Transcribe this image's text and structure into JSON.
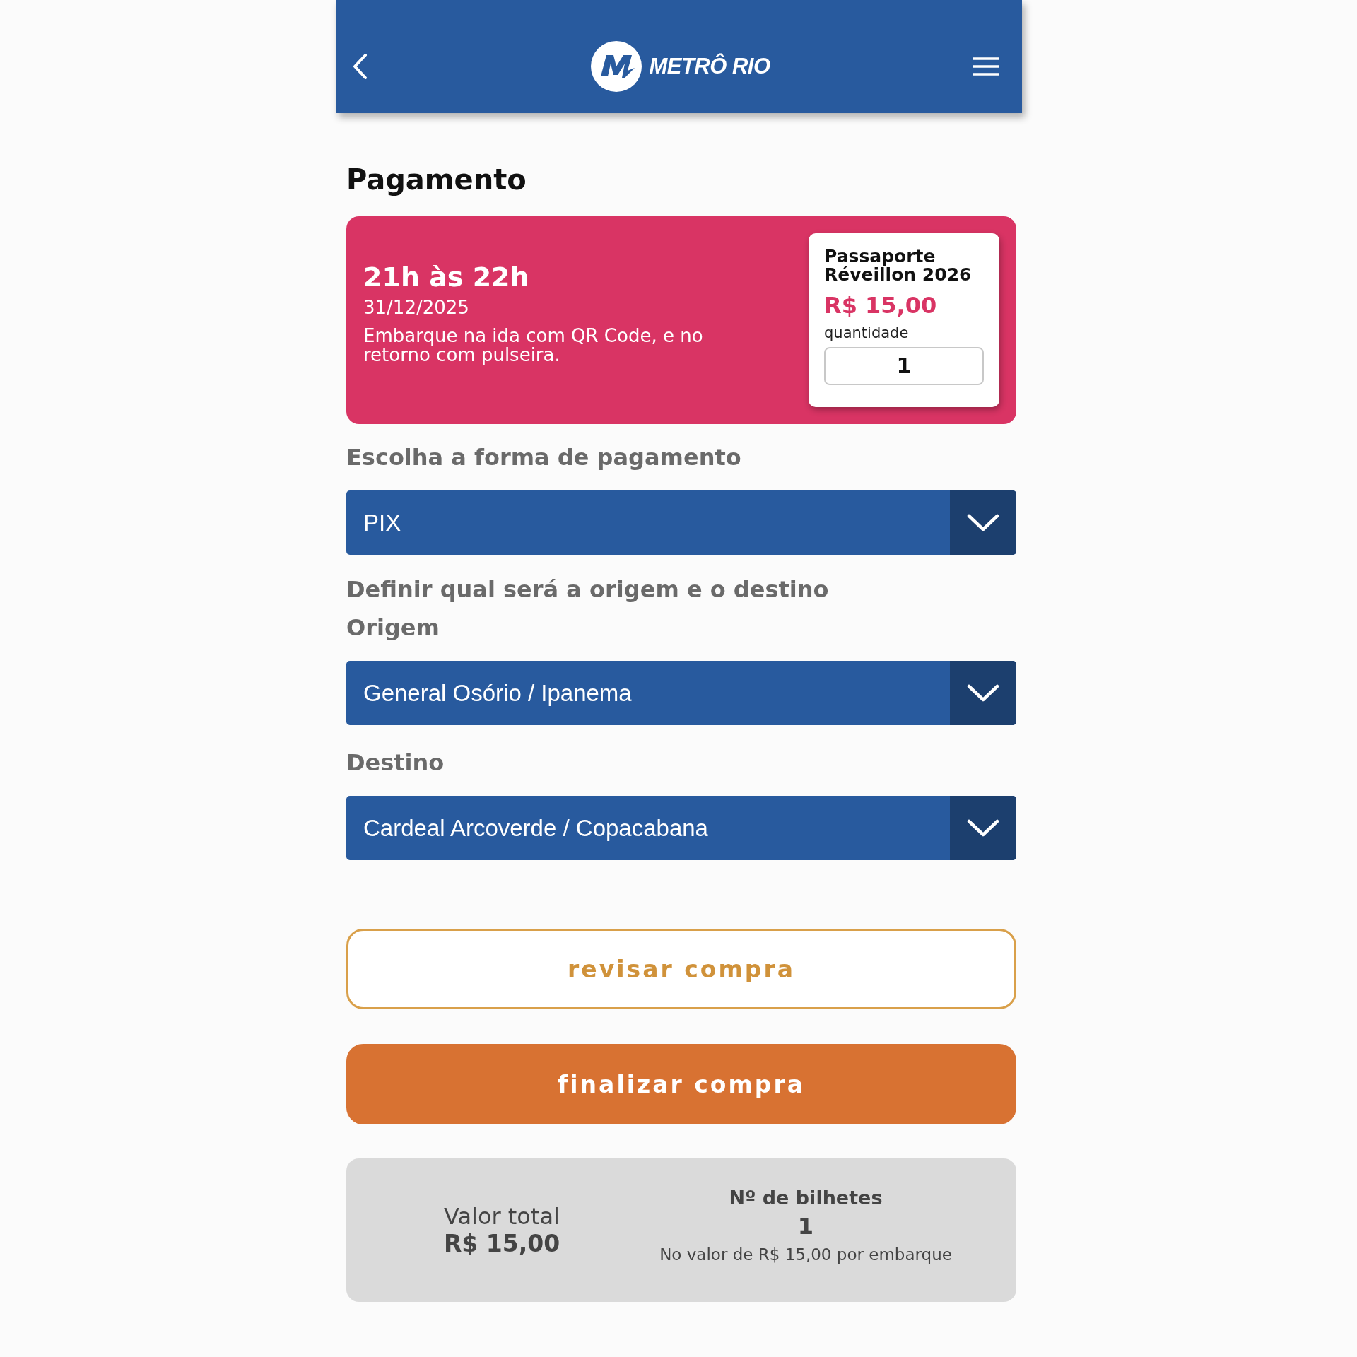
{
  "header": {
    "logo_text": "METRÔ RIO"
  },
  "title": "Pagamento",
  "event_card": {
    "time": "21h às 22h",
    "date": "31/12/2025",
    "note": "Embarque na ida com QR Code, e no retorno com pulseira.",
    "ticket": {
      "name": "Passaporte Réveillon 2026",
      "price": "R$ 15,00",
      "quantity_label": "quantidade",
      "quantity": "1"
    }
  },
  "payment": {
    "label": "Escolha a forma de pagamento",
    "value": "PIX"
  },
  "route": {
    "label": "Definir qual será a origem e o destino",
    "fields": [
      {
        "label": "Origem",
        "value": "General Osório / Ipanema"
      },
      {
        "label": "Destino",
        "value": "Cardeal Arcoverde / Copacabana"
      }
    ]
  },
  "buttons": [
    {
      "label": "revisar compra",
      "kind": "outline"
    },
    {
      "label": "finalizar compra",
      "kind": "filled"
    }
  ],
  "summary": {
    "total_label": "Valor total",
    "total": "R$ 15,00",
    "tickets_label": "Nº de bilhetes",
    "tickets": "1",
    "note": "No valor de R$ 15,00 por embarque"
  }
}
